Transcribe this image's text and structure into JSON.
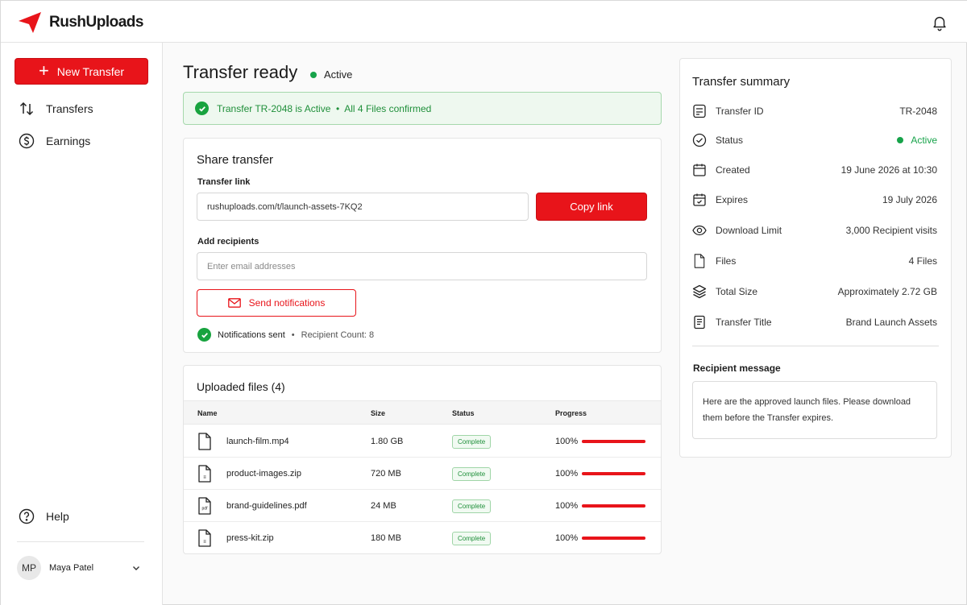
{
  "app": {
    "name": "RushUploads",
    "accent": "#e8141a",
    "success": "#17a34a"
  },
  "sidebar": {
    "new_transfer": "New Transfer",
    "items": [
      {
        "label": "Transfers",
        "icon": "arrows-up-down-icon"
      },
      {
        "label": "Earnings",
        "icon": "dollar-circle-icon"
      }
    ],
    "help": "Help",
    "user": {
      "initials": "MP",
      "name": "Maya Patel"
    }
  },
  "header": {
    "title": "Transfer ready",
    "status": "Active"
  },
  "banner": {
    "message": "Transfer TR-2048 is Active  •  All 4 Files confirmed"
  },
  "share": {
    "title": "Share transfer",
    "link_label": "Transfer link",
    "link_value": "rushuploads.com/t/launch-assets-7KQ2",
    "copy_label": "Copy link",
    "recipients_label": "Add recipients",
    "recipients_placeholder": "Enter email addresses",
    "send_label": "Send notifications",
    "notif_sent": "Notifications sent",
    "recipient_count": "Recipient Count: 8"
  },
  "files": {
    "title": "Uploaded files (4)",
    "columns": [
      "Name",
      "Size",
      "Status",
      "Progress"
    ],
    "rows": [
      {
        "name": "launch-film.mp4",
        "size": "1.80 GB",
        "status": "Complete",
        "progress_text": "100%",
        "progress": 1.0,
        "icon": "file-icon"
      },
      {
        "name": "product-images.zip",
        "size": "720 MB",
        "status": "Complete",
        "progress_text": "100%",
        "progress": 1.0,
        "icon": "zip-file-icon"
      },
      {
        "name": "brand-guidelines.pdf",
        "size": "24 MB",
        "status": "Complete",
        "progress_text": "100%",
        "progress": 1.0,
        "icon": "pdf-file-icon"
      },
      {
        "name": "press-kit.zip",
        "size": "180 MB",
        "status": "Complete",
        "progress_text": "100%",
        "progress": 1.0,
        "icon": "zip-file-icon"
      }
    ]
  },
  "summary": {
    "title": "Transfer summary",
    "rows": [
      {
        "label": "Transfer ID",
        "value": "TR-2048",
        "icon": "id-card-icon"
      },
      {
        "label": "Status",
        "value": "Active",
        "icon": "check-circle-icon"
      },
      {
        "label": "Created",
        "value": "19 June 2026 at 10:30",
        "icon": "calendar-icon"
      },
      {
        "label": "Expires",
        "value": "19 July 2026",
        "icon": "calendar-check-icon"
      },
      {
        "label": "Download Limit",
        "value": "3,000 Recipient visits",
        "icon": "eye-icon"
      },
      {
        "label": "Files",
        "value": "4 Files",
        "icon": "file-icon"
      },
      {
        "label": "Total Size",
        "value": "Approximately 2.72 GB",
        "icon": "layers-icon"
      },
      {
        "label": "Transfer Title",
        "value": "Brand Launch Assets",
        "icon": "document-text-icon"
      }
    ],
    "message_label": "Recipient message",
    "message": "Here are the approved launch files. Please download them before the Transfer expires."
  }
}
